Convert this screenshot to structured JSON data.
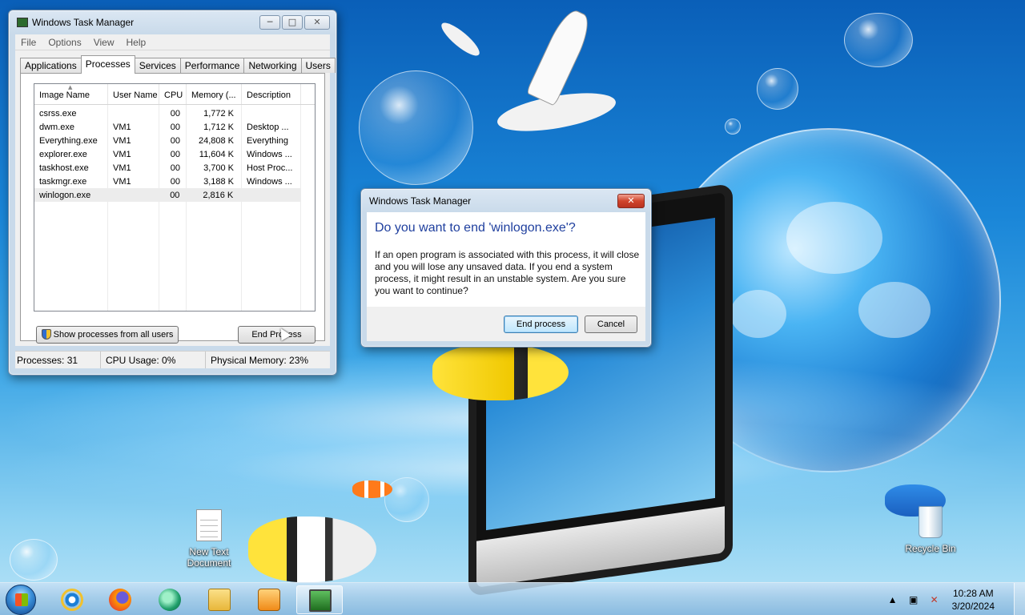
{
  "task_manager": {
    "title": "Windows Task Manager",
    "menu": [
      "File",
      "Options",
      "View",
      "Help"
    ],
    "tabs": [
      "Applications",
      "Processes",
      "Services",
      "Performance",
      "Networking",
      "Users"
    ],
    "active_tab": "Processes",
    "columns": [
      "Image Name",
      "User Name",
      "CPU",
      "Memory (...",
      "Description"
    ],
    "processes": [
      {
        "image": "csrss.exe",
        "user": "",
        "cpu": "00",
        "memory": "1,772 K",
        "description": ""
      },
      {
        "image": "dwm.exe",
        "user": "VM1",
        "cpu": "00",
        "memory": "1,712 K",
        "description": "Desktop ..."
      },
      {
        "image": "Everything.exe",
        "user": "VM1",
        "cpu": "00",
        "memory": "24,808 K",
        "description": "Everything"
      },
      {
        "image": "explorer.exe",
        "user": "VM1",
        "cpu": "00",
        "memory": "11,604 K",
        "description": "Windows ..."
      },
      {
        "image": "taskhost.exe",
        "user": "VM1",
        "cpu": "00",
        "memory": "3,700 K",
        "description": "Host Proc..."
      },
      {
        "image": "taskmgr.exe",
        "user": "VM1",
        "cpu": "00",
        "memory": "3,188 K",
        "description": "Windows ..."
      },
      {
        "image": "winlogon.exe",
        "user": "",
        "cpu": "00",
        "memory": "2,816 K",
        "description": ""
      }
    ],
    "show_all_label": "Show processes from all users",
    "end_process_label": "End Process",
    "status": {
      "processes": "Processes: 31",
      "cpu": "CPU Usage: 0%",
      "memory": "Physical Memory: 23%"
    }
  },
  "dialog": {
    "title": "Windows Task Manager",
    "question": "Do you want to end 'winlogon.exe'?",
    "message": "If an open program is associated with this process, it will close and you will lose any unsaved data. If you end a system process, it might result in an unstable system. Are you sure you want to continue?",
    "confirm_label": "End process",
    "cancel_label": "Cancel"
  },
  "desktop": {
    "icons": [
      {
        "label": "New Text Document",
        "icon": "text-document-icon"
      },
      {
        "label": "Recycle Bin",
        "icon": "recycle-bin-icon"
      }
    ]
  },
  "taskbar": {
    "pinned": [
      "internet-explorer-icon",
      "firefox-icon",
      "everything-search-icon",
      "file-explorer-icon",
      "media-player-icon",
      "task-manager-icon"
    ],
    "time": "10:28 AM",
    "date": "3/20/2024"
  },
  "colors": {
    "dialog_heading": "#1f3f9e",
    "close_button": "#d0442c",
    "selected_row": "#ececec"
  }
}
